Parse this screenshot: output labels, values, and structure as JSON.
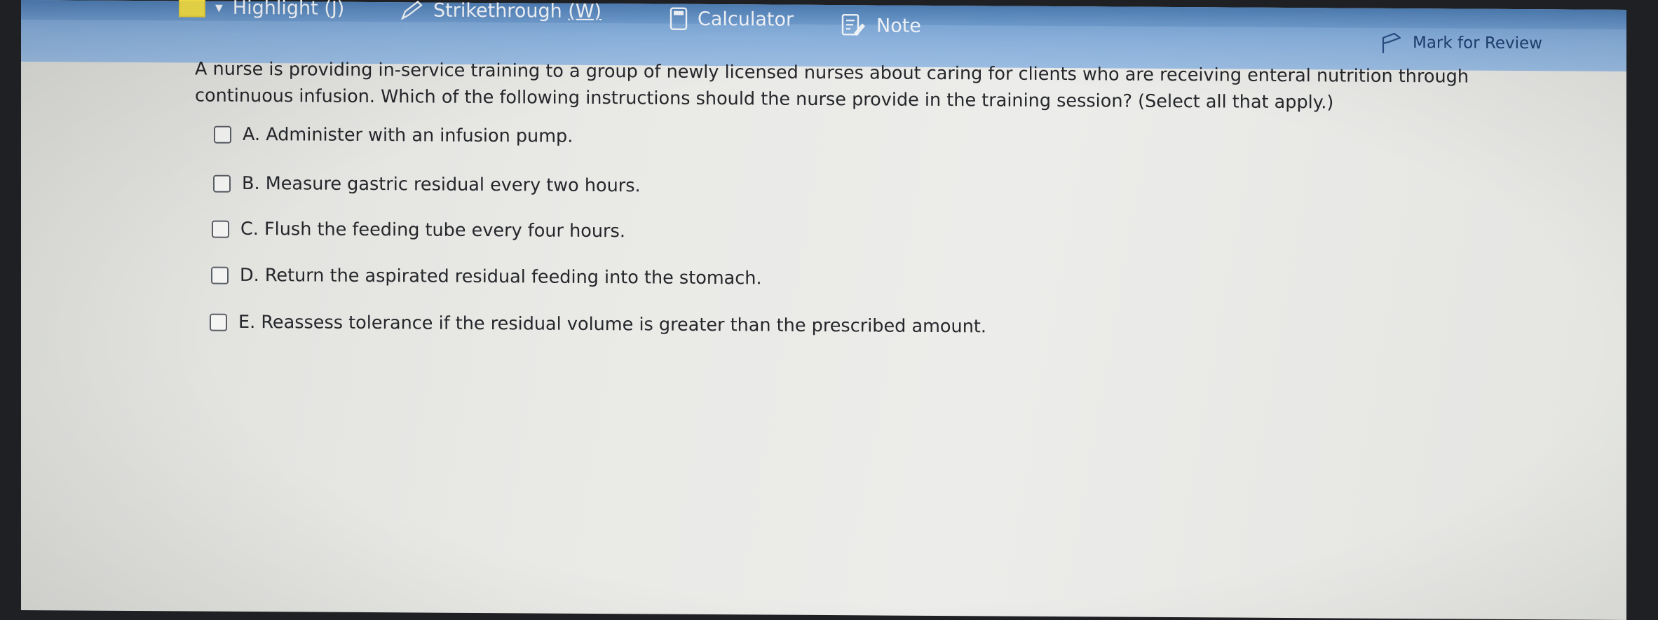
{
  "toolbar": {
    "highlight_label": "Highlight",
    "highlight_key": "(J)",
    "strikethrough_label": "Strikethrough",
    "strikethrough_key": "(W)",
    "calculator_label": "Calculator",
    "note_label": "Note",
    "mark_for_review_label": "Mark for Review"
  },
  "question": {
    "text": "A nurse is providing in-service training to a group of newly licensed nurses about caring for clients who are receiving enteral nutrition through continuous infusion. Which of the following instructions should the nurse provide in the training session? (Select all that apply.)"
  },
  "options": [
    {
      "label": "A. Administer with an infusion pump."
    },
    {
      "label": "B. Measure gastric residual every two hours."
    },
    {
      "label": "C. Flush the feeding tube every four hours."
    },
    {
      "label": "D. Return the aspirated residual feeding into the stomach."
    },
    {
      "label": "E. Reassess tolerance if the residual volume is greater than the prescribed amount."
    }
  ],
  "colors": {
    "toolbar": "#8cb3df",
    "text": "#24262a",
    "mark_review_text": "#1e3f70"
  }
}
